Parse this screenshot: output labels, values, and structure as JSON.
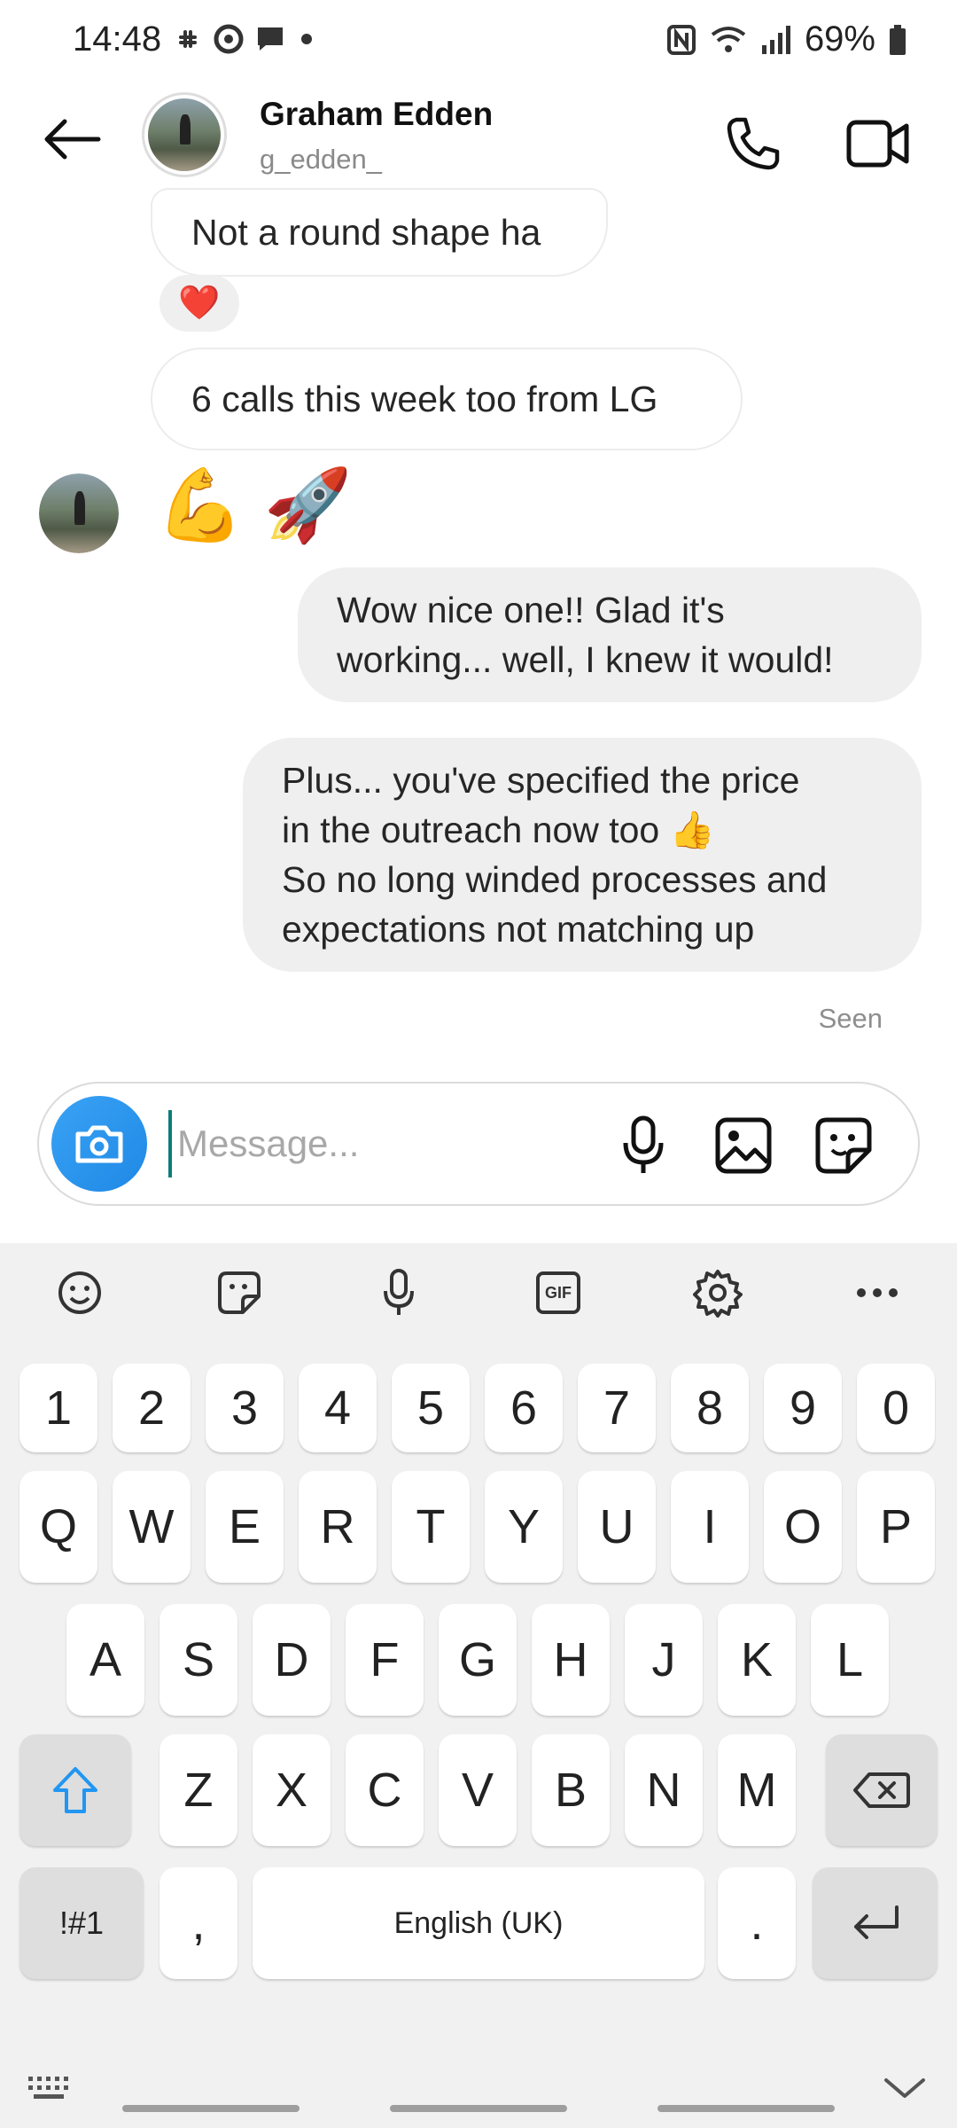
{
  "status_bar": {
    "time": "14:48",
    "battery": "69%",
    "icons": [
      "slack-icon",
      "sync-icon",
      "chat-icon",
      "dot-icon",
      "nfc-icon",
      "wifi-icon",
      "signal-icon",
      "battery-icon"
    ]
  },
  "header": {
    "name": "Graham Edden",
    "username": "g_edden_"
  },
  "messages": {
    "m1": "Not a round shape ha",
    "m1_reaction": "❤️",
    "m2": "6 calls this week too from LG",
    "m3": "💪 🚀",
    "m4_line1": "Wow nice one!! Glad it's",
    "m4_line2": "working... well, I knew it would!",
    "m5_line1": "Plus... you've specified the price",
    "m5_line2": "in the outreach now too 👍",
    "m5_line3": "So no long winded processes and",
    "m5_line4": "expectations not matching up",
    "seen": "Seen"
  },
  "composer": {
    "placeholder": "Message..."
  },
  "keyboard": {
    "toolbar": [
      "emoji-icon",
      "sticker-icon",
      "mic-icon",
      "gif-icon",
      "settings-icon",
      "more-icon"
    ],
    "gif_label": "GIF",
    "row_numbers": [
      "1",
      "2",
      "3",
      "4",
      "5",
      "6",
      "7",
      "8",
      "9",
      "0"
    ],
    "row_top": [
      "Q",
      "W",
      "E",
      "R",
      "T",
      "Y",
      "U",
      "I",
      "O",
      "P"
    ],
    "row_mid": [
      "A",
      "S",
      "D",
      "F",
      "G",
      "H",
      "J",
      "K",
      "L"
    ],
    "row_bottom": [
      "Z",
      "X",
      "C",
      "V",
      "B",
      "N",
      "M"
    ],
    "symbols": "!#1",
    "comma": ",",
    "space": "English (UK)",
    "period": "."
  },
  "colors": {
    "accent": "#2196f3",
    "bubble_sent": "#efefef",
    "keyboard_bg": "#f1f1f1"
  }
}
